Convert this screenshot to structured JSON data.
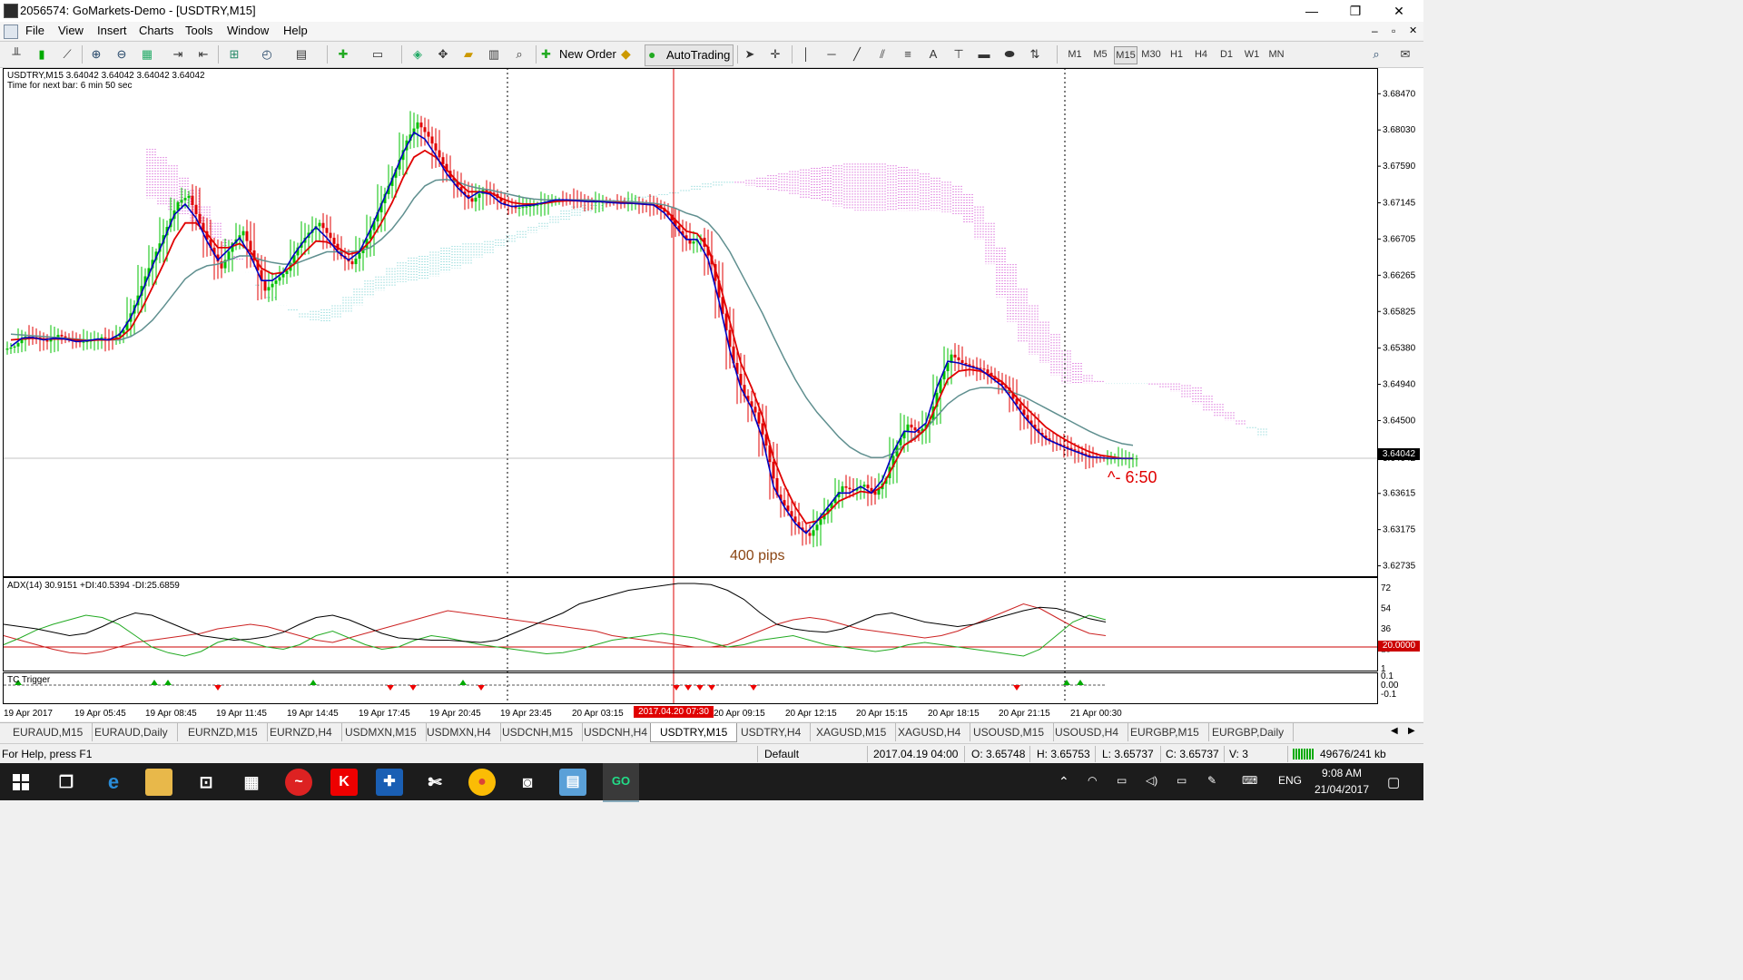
{
  "window": {
    "title": "2056574: GoMarkets-Demo - [USDTRY,M15]",
    "minimize_glyph": "—",
    "restore_glyph": "❐",
    "close_glyph": "✕",
    "inner_min_glyph": "–",
    "inner_restore_glyph": "▫",
    "inner_close_glyph": "✕"
  },
  "menu": [
    "File",
    "View",
    "Insert",
    "Charts",
    "Tools",
    "Window",
    "Help"
  ],
  "toolbar": {
    "new_order_label": "New Order",
    "autotrading_label": "AutoTrading",
    "text_tool_label": "A",
    "timeframes": [
      "M1",
      "M5",
      "M15",
      "M30",
      "H1",
      "H4",
      "D1",
      "W1",
      "MN"
    ],
    "active_timeframe": "M15"
  },
  "chart": {
    "info_line": "USDTRY,M15  3.64042 3.64042 3.64042 3.64042",
    "next_bar_text": "Time for next bar: 6 min 50 sec",
    "annotation_pips": "400 pips",
    "annotation_timer": "^- 6:50",
    "current_price_label": "3.64042",
    "adx_label": "ADX(14) 30.9151 +DI:40.5394 -DI:25.6859",
    "adx_level_label": "20.0000",
    "tc_trigger_label": "TC Trigger",
    "highlight_time_label": "2017.04.20 07:30",
    "colors": {
      "bull_candle": "#00c000",
      "bear_candle": "#e00000",
      "ma_fast": "#0000c0",
      "ma_mid": "#e00000",
      "ma_slow": "#5f8f8f",
      "cloud_bear": "#cc33cc",
      "cloud_bull": "#66cccc",
      "adx": "#000000",
      "plus_di": "#22aa22",
      "minus_di": "#cc2222",
      "timer_text": "#e00000",
      "pips_text": "#8b4513"
    }
  },
  "chart_data": {
    "type": "candlestick",
    "symbol": "USDTRY",
    "timeframe": "M15",
    "price_axis_ticks": [
      "3.68470",
      "3.68030",
      "3.67590",
      "3.67145",
      "3.66705",
      "3.66265",
      "3.65825",
      "3.65380",
      "3.64940",
      "3.64500",
      "3.64042",
      "3.63615",
      "3.63175",
      "3.62735"
    ],
    "ylim": [
      3.6262,
      3.6876
    ],
    "time_axis_ticks": [
      "19 Apr 2017",
      "19 Apr 05:45",
      "19 Apr 08:45",
      "19 Apr 11:45",
      "19 Apr 14:45",
      "19 Apr 17:45",
      "19 Apr 20:45",
      "19 Apr 23:45",
      "20 Apr 03:15",
      "2017.04.20 07:30",
      "20 Apr 09:15",
      "20 Apr 12:15",
      "20 Apr 15:15",
      "20 Apr 18:15",
      "20 Apr 21:15",
      "21 Apr 00:30"
    ],
    "price_path": [
      3.654,
      3.6552,
      3.6551,
      3.6546,
      3.6554,
      3.6549,
      3.6545,
      3.6547,
      3.6551,
      3.6548,
      3.656,
      3.659,
      3.6625,
      3.6655,
      3.6685,
      3.6715,
      3.6723,
      3.669,
      3.666,
      3.6635,
      3.6665,
      3.668,
      3.6645,
      3.6608,
      3.662,
      3.6632,
      3.666,
      3.6678,
      3.669,
      3.6672,
      3.665,
      3.664,
      3.666,
      3.6692,
      3.6725,
      3.6755,
      3.679,
      3.6812,
      3.6795,
      3.677,
      3.6745,
      3.6728,
      3.6716,
      3.673,
      3.6725,
      3.6712,
      3.6708,
      3.671,
      3.6712,
      3.6716,
      3.6719,
      3.6718,
      3.6717,
      3.6716,
      3.6716,
      3.6715,
      3.6714,
      3.6714,
      3.6713,
      3.6712,
      3.67,
      3.668,
      3.6665,
      3.6672,
      3.664,
      3.658,
      3.652,
      3.648,
      3.646,
      3.642,
      3.636,
      3.634,
      3.632,
      3.631,
      3.633,
      3.635,
      3.637,
      3.6365,
      3.6372,
      3.636,
      3.638,
      3.642,
      3.6445,
      3.6435,
      3.645,
      3.65,
      3.653,
      3.652,
      3.6515,
      3.6512,
      3.65,
      3.649,
      3.647,
      3.645,
      3.6435,
      3.6425,
      3.642,
      3.6415,
      3.641,
      3.6405,
      3.6404,
      3.6404,
      3.6404,
      3.6404
    ],
    "ma_fast": [
      3.654,
      3.655,
      3.6551,
      3.6548,
      3.655,
      3.6549,
      3.6546,
      3.6547,
      3.6549,
      3.6548,
      3.6555,
      3.6575,
      3.6605,
      3.6638,
      3.6668,
      3.67,
      3.6713,
      3.6696,
      3.6668,
      3.6645,
      3.6658,
      3.6672,
      3.665,
      3.662,
      3.662,
      3.663,
      3.6652,
      3.667,
      3.6685,
      3.6672,
      3.6655,
      3.6645,
      3.6655,
      3.6682,
      3.6712,
      3.6743,
      3.6775,
      3.68,
      3.6792,
      3.6772,
      3.675,
      3.6733,
      3.672,
      3.6728,
      3.6725,
      3.6714,
      3.671,
      3.6711,
      3.6712,
      3.6715,
      3.6718,
      3.6718,
      3.6717,
      3.6716,
      3.6716,
      3.6715,
      3.6714,
      3.6714,
      3.6713,
      3.6712,
      3.6702,
      3.6686,
      3.667,
      3.667,
      3.6646,
      3.6595,
      3.6535,
      3.649,
      3.6465,
      3.6428,
      3.637,
      3.6345,
      3.6325,
      3.6313,
      3.6328,
      3.6345,
      3.6362,
      3.6362,
      3.637,
      3.6362,
      3.6378,
      3.6412,
      3.6437,
      3.6436,
      3.6447,
      3.649,
      3.6522,
      3.652,
      3.6516,
      3.6512,
      3.6502,
      3.6492,
      3.6474,
      3.6455,
      3.644,
      3.6428,
      3.6422,
      3.6416,
      3.6411,
      3.6406,
      3.6405,
      3.6404,
      3.6404,
      3.6404
    ],
    "ma_mid": [
      3.6548,
      3.6549,
      3.655,
      3.6549,
      3.6549,
      3.6549,
      3.6548,
      3.6547,
      3.6548,
      3.6548,
      3.655,
      3.6562,
      3.6585,
      3.6612,
      3.664,
      3.667,
      3.669,
      3.669,
      3.6677,
      3.666,
      3.666,
      3.6665,
      3.6655,
      3.6635,
      3.6628,
      3.663,
      3.664,
      3.6655,
      3.6668,
      3.6667,
      3.666,
      3.6652,
      3.6655,
      3.6668,
      3.669,
      3.6715,
      3.6745,
      3.677,
      3.6778,
      3.677,
      3.6755,
      3.674,
      3.6728,
      3.6728,
      3.6727,
      3.672,
      3.6715,
      3.6713,
      3.6713,
      3.6714,
      3.6716,
      3.6717,
      3.6717,
      3.6716,
      3.6716,
      3.6715,
      3.6715,
      3.6714,
      3.6713,
      3.6712,
      3.6707,
      3.6694,
      3.668,
      3.6677,
      3.666,
      3.662,
      3.657,
      3.652,
      3.649,
      3.6455,
      3.6405,
      3.6372,
      3.6345,
      3.6325,
      3.6328,
      3.6338,
      3.6352,
      3.6358,
      3.6364,
      3.6362,
      3.637,
      3.6395,
      3.642,
      3.6428,
      3.644,
      3.647,
      3.65,
      3.651,
      3.6512,
      3.651,
      3.6505,
      3.6497,
      3.6483,
      3.6468,
      3.6455,
      3.6442,
      3.6433,
      3.6425,
      3.6418,
      3.6412,
      3.6408,
      3.6406,
      3.6404,
      3.6404
    ],
    "ma_slow": [
      3.6555,
      3.6554,
      3.6553,
      3.6552,
      3.6551,
      3.655,
      3.6549,
      3.6548,
      3.6548,
      3.6548,
      3.6548,
      3.6552,
      3.656,
      3.6572,
      3.6588,
      3.6605,
      3.6622,
      3.6632,
      3.6638,
      3.664,
      3.6645,
      3.665,
      3.665,
      3.6645,
      3.6642,
      3.664,
      3.664,
      3.6645,
      3.665,
      3.6655,
      3.6655,
      3.6655,
      3.6656,
      3.666,
      3.667,
      3.6683,
      3.67,
      3.672,
      3.6735,
      3.6742,
      3.6743,
      3.674,
      3.6735,
      3.6732,
      3.673,
      3.6727,
      3.6724,
      3.6721,
      3.6719,
      3.6718,
      3.6718,
      3.6718,
      3.6718,
      3.6718,
      3.6717,
      3.6717,
      3.6716,
      3.6716,
      3.6715,
      3.6714,
      3.6712,
      3.6708,
      3.6702,
      3.6698,
      3.669,
      3.6675,
      3.6655,
      3.663,
      3.6605,
      3.658,
      3.6552,
      3.6525,
      3.65,
      3.6478,
      3.646,
      3.6445,
      3.643,
      3.6418,
      3.641,
      3.6405,
      3.6405,
      3.641,
      3.642,
      3.643,
      3.644,
      3.6455,
      3.647,
      3.648,
      3.6487,
      3.649,
      3.649,
      3.6488,
      3.6484,
      3.6479,
      3.6472,
      3.6465,
      3.6458,
      3.6451,
      3.6444,
      3.6437,
      3.6431,
      3.6426,
      3.6422,
      3.642
    ],
    "cloud_a": [
      3.672,
      3.6712,
      3.6706,
      3.67,
      3.669,
      3.668,
      3.667,
      3.666,
      3.6645,
      3.663,
      3.6615,
      3.66,
      3.659,
      3.6585,
      3.658,
      3.6583,
      3.6585,
      3.659,
      3.66,
      3.661,
      3.662,
      3.6625,
      3.6635,
      3.6642,
      3.6648,
      3.665,
      3.6655,
      3.666,
      3.6662,
      3.6665,
      3.6665,
      3.6668,
      3.667,
      3.6675,
      3.668,
      3.6685,
      3.669,
      3.6698,
      3.6705,
      3.671,
      3.6712,
      3.6715,
      3.6717,
      3.6718,
      3.672,
      3.6722,
      3.6723,
      3.6725,
      3.6727,
      3.673,
      3.6735,
      3.6738,
      3.674,
      3.674,
      3.6738,
      3.6735,
      3.6733,
      3.673,
      3.6728,
      3.6725,
      3.672,
      3.6718,
      3.6715,
      3.671,
      3.6708,
      3.6705,
      3.6705,
      3.6705,
      3.6705,
      3.6705,
      3.6705,
      3.6705,
      3.6705,
      3.6703,
      3.67,
      3.669,
      3.667,
      3.664,
      3.66,
      3.657,
      3.6545,
      3.653,
      3.652,
      3.6505,
      3.6495,
      3.6495,
      3.6495,
      3.6495,
      3.6495,
      3.6495,
      3.6495,
      3.6495,
      3.6493,
      3.649,
      3.6485,
      3.6478,
      3.647,
      3.6462,
      3.6455,
      3.645,
      3.6445,
      3.6442,
      3.644,
      3.644
    ],
    "cloud_b": [
      3.678,
      3.677,
      3.676,
      3.6745,
      3.673,
      3.671,
      3.669,
      3.667,
      3.665,
      3.663,
      3.6612,
      3.6598,
      3.659,
      3.6582,
      3.6575,
      3.6572,
      3.657,
      3.6574,
      3.6582,
      3.659,
      3.66,
      3.6608,
      3.6612,
      3.6618,
      3.662,
      3.6622,
      3.6625,
      3.663,
      3.6635,
      3.664,
      3.6648,
      3.6652,
      3.666,
      3.6665,
      3.6672,
      3.6678,
      3.6683,
      3.6688,
      3.6692,
      3.6698,
      3.6702,
      3.6708,
      3.6712,
      3.6715,
      3.6718,
      3.672,
      3.6722,
      3.6724,
      3.6726,
      3.6728,
      3.673,
      3.6732,
      3.6735,
      3.6737,
      3.674,
      3.6742,
      3.6745,
      3.6748,
      3.675,
      3.6753,
      3.6755,
      3.6757,
      3.6758,
      3.676,
      3.6762,
      3.6762,
      3.6762,
      3.6762,
      3.676,
      3.6758,
      3.6755,
      3.675,
      3.6745,
      3.674,
      3.6735,
      3.6725,
      3.671,
      3.669,
      3.666,
      3.664,
      3.661,
      3.659,
      3.657,
      3.6555,
      3.6535,
      3.652,
      3.6505,
      3.6498,
      3.6495,
      3.6495,
      3.6495,
      3.6495,
      3.6495,
      3.6495,
      3.6495,
      3.6493,
      3.649,
      3.648,
      3.647,
      3.646,
      3.645,
      3.644,
      3.643,
      3.6425
    ],
    "adx_axis_ticks": [
      "72",
      "54",
      "36",
      "18",
      "1"
    ],
    "adx_ylim": [
      0,
      80
    ],
    "adx_level": 20,
    "adx": [
      40,
      38,
      36,
      33,
      30,
      32,
      38,
      45,
      50,
      48,
      42,
      36,
      30,
      28,
      26,
      27,
      29,
      33,
      40,
      46,
      48,
      44,
      38,
      32,
      28,
      27,
      26,
      26,
      25,
      24,
      26,
      32,
      38,
      44,
      50,
      58,
      62,
      66,
      70,
      72,
      74,
      76,
      76,
      75,
      70,
      62,
      50,
      40,
      36,
      34,
      33,
      36,
      42,
      48,
      50,
      46,
      42,
      40,
      38,
      40,
      44,
      48,
      52,
      55,
      54,
      50,
      45,
      42
    ],
    "plus_di": [
      22,
      28,
      35,
      40,
      44,
      48,
      46,
      40,
      30,
      20,
      15,
      12,
      16,
      24,
      28,
      24,
      20,
      18,
      22,
      30,
      34,
      28,
      22,
      18,
      20,
      26,
      30,
      28,
      25,
      22,
      20,
      18,
      16,
      14,
      15,
      18,
      22,
      26,
      28,
      30,
      32,
      30,
      28,
      24,
      20,
      22,
      26,
      28,
      30,
      26,
      22,
      20,
      18,
      16,
      18,
      22,
      24,
      22,
      20,
      18,
      16,
      14,
      12,
      18,
      30,
      42,
      48,
      44
    ],
    "minus_di": [
      30,
      26,
      22,
      18,
      15,
      14,
      16,
      20,
      24,
      26,
      28,
      30,
      32,
      36,
      38,
      40,
      38,
      34,
      30,
      26,
      24,
      28,
      32,
      36,
      40,
      44,
      48,
      52,
      50,
      48,
      46,
      44,
      42,
      40,
      38,
      36,
      34,
      30,
      28,
      26,
      24,
      22,
      20,
      20,
      22,
      28,
      34,
      40,
      44,
      46,
      44,
      40,
      36,
      34,
      32,
      30,
      28,
      30,
      34,
      40,
      46,
      52,
      58,
      54,
      46,
      38,
      32,
      30
    ],
    "tc_trigger_signals": [
      "up",
      "up",
      "up",
      "down",
      "up",
      "down",
      "down",
      "up",
      "down",
      "down",
      "down",
      "down",
      "down",
      "down",
      "down",
      "up",
      "up"
    ]
  },
  "tabs": [
    "EURAUD,M15",
    "EURAUD,Daily",
    "EURNZD,M15",
    "EURNZD,H4",
    "USDMXN,M15",
    "USDMXN,H4",
    "USDCNH,M15",
    "USDCNH,H4",
    "USDTRY,M15",
    "USDTRY,H4",
    "XAGUSD,M15",
    "XAGUSD,H4",
    "USOUSD,M15",
    "USOUSD,H4",
    "EURGBP,M15",
    "EURGBP,Daily"
  ],
  "active_tab": "USDTRY,M15",
  "tab_nav": {
    "left": "◀",
    "right": "▶"
  },
  "status": {
    "help_text": "For Help, press F1",
    "profile": "Default",
    "bar_time": "2017.04.19 04:00",
    "open": "O: 3.65748",
    "high": "H: 3.65753",
    "low": "L: 3.65737",
    "close": "C: 3.65737",
    "volume": "V: 3",
    "traffic": "49676/241 kb"
  },
  "taskbar": {
    "time": "9:08 AM",
    "date": "21/04/2017",
    "language": "ENG"
  }
}
